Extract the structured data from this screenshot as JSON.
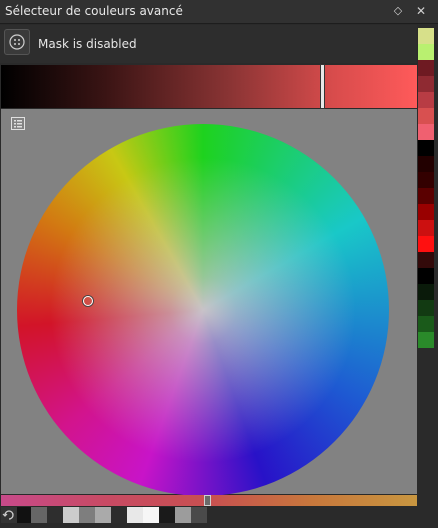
{
  "window": {
    "title": "Sélecteur de couleurs avancé",
    "float_icon": "diamond-float-icon",
    "close_icon": "close-icon"
  },
  "mask": {
    "text": "Mask is disabled",
    "icon": "mask-icon"
  },
  "colors": {
    "accent_red": "#d84c4c",
    "wheel_background": "#828282",
    "panel_background": "#2a2a2a"
  },
  "history_swatches": [
    "#111111",
    "#666666",
    "#2e2e2e",
    "#cccccc",
    "#7e7e7e",
    "#aaaaaa",
    "#2c2c2c",
    "#e8e8e8",
    "#f6f6f6",
    "#1a1a1a",
    "#9c9c9c",
    "#4a4a4a"
  ],
  "side_swatches": [
    "#d7e08a",
    "#b9f070",
    "#6e1a22",
    "#8f2a32",
    "#b83c44",
    "#d85050",
    "#f06070",
    "#000000",
    "#220000",
    "#330000",
    "#5a0000",
    "#990000",
    "#cc1010",
    "#ff1010",
    "#330a0a",
    "#000000",
    "#0a1a0a",
    "#123a12",
    "#1a5a1a",
    "#2a8a2a"
  ]
}
